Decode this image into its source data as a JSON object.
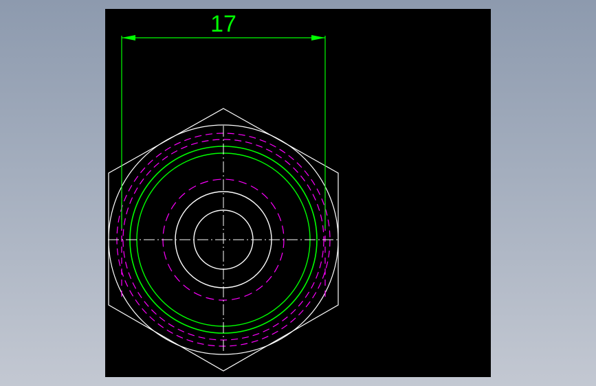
{
  "drawing": {
    "dimension_text": "17",
    "colors": {
      "background": "#000000",
      "object": "#ffffff",
      "dimension": "#00ff00",
      "hidden": "#ff00ff",
      "center": "#ffffff"
    }
  }
}
